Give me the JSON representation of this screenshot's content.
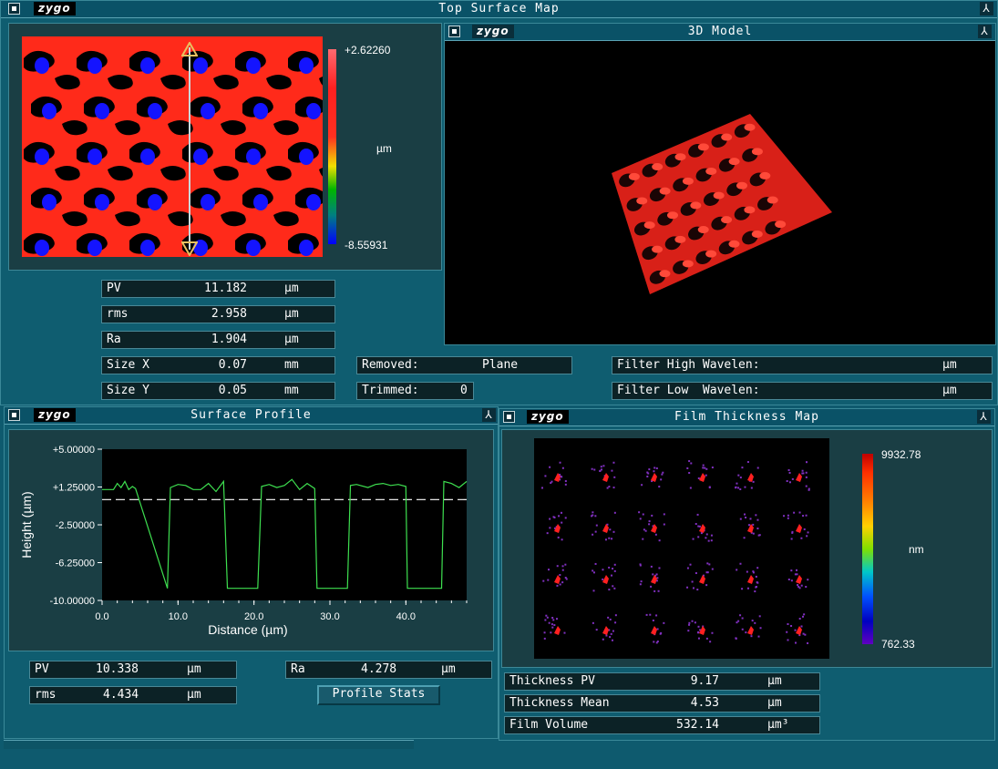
{
  "top_window": {
    "title": "Top Surface Map",
    "logo": "zygo"
  },
  "surface_map": {
    "colorbar_max": "+2.62260",
    "colorbar_min": "-8.55931",
    "colorbar_unit": "µm",
    "colors": {
      "high": "#ff2a1a",
      "mid": "#00c800",
      "low": "#1414ff"
    }
  },
  "surface_stats": [
    {
      "label": "PV",
      "value": "11.182",
      "unit": "µm"
    },
    {
      "label": "rms",
      "value": "2.958",
      "unit": "µm"
    },
    {
      "label": "Ra",
      "value": "1.904",
      "unit": "µm"
    },
    {
      "label": "Size X",
      "value": "0.07",
      "unit": "mm"
    },
    {
      "label": "Size Y",
      "value": "0.05",
      "unit": "mm"
    }
  ],
  "removed": {
    "label": "Removed:",
    "value": "Plane"
  },
  "trimmed": {
    "label": "Trimmed:",
    "value": "0"
  },
  "filter_high": {
    "label": "Filter High Wavelen:",
    "unit": "µm"
  },
  "filter_low": {
    "label": "Filter Low  Wavelen:",
    "unit": "µm"
  },
  "model_window": {
    "title": "3D Model",
    "logo": "zygo"
  },
  "profile_window": {
    "title": "Surface Profile",
    "logo": "zygo"
  },
  "profile_chart": {
    "ylabel": "Height (µm)",
    "xlabel": "Distance (µm)",
    "y_ticks": [
      "+5.00000",
      "+1.25000",
      "-2.50000",
      "-6.25000",
      "-10.00000"
    ],
    "x_ticks": [
      "0.0",
      "10.0",
      "20.0",
      "30.0",
      "40.0"
    ]
  },
  "chart_data": {
    "type": "line",
    "xlabel": "Distance (µm)",
    "ylabel": "Height (µm)",
    "xlim": [
      0,
      48
    ],
    "ylim": [
      -10,
      5
    ],
    "reference_line": 0,
    "x": [
      0,
      1.5,
      2,
      2.5,
      3,
      3.5,
      4,
      4.4,
      8.6,
      9,
      10,
      11,
      12,
      13,
      14,
      15,
      16,
      16.5,
      20.5,
      21,
      22,
      23,
      24,
      25,
      26,
      27,
      28,
      28.3,
      32.3,
      32.7,
      33.5,
      35,
      36,
      37,
      38,
      39,
      40,
      40.2,
      44.7,
      45,
      46,
      47,
      48
    ],
    "y": [
      1,
      1,
      1.6,
      1.2,
      1.8,
      1.0,
      1.3,
      1.1,
      -8.8,
      1.2,
      1.5,
      1.4,
      1.0,
      1.0,
      1.6,
      0.8,
      1.8,
      -8.8,
      -8.8,
      1.3,
      1.5,
      1.2,
      1.4,
      2.0,
      1.0,
      1.6,
      1.1,
      -8.8,
      -8.8,
      1.4,
      1.5,
      1.2,
      1.5,
      1.6,
      1.4,
      1.5,
      1.3,
      -8.8,
      -8.8,
      1.8,
      1.6,
      1.2,
      1.8
    ]
  },
  "profile_stats": {
    "pv": {
      "label": "PV",
      "value": "10.338",
      "unit": "µm"
    },
    "rms": {
      "label": "rms",
      "value": "4.434",
      "unit": "µm"
    },
    "ra": {
      "label": "Ra",
      "value": "4.278",
      "unit": "µm"
    },
    "button": "Profile Stats"
  },
  "film_window": {
    "title": "Film Thickness Map",
    "logo": "zygo"
  },
  "film_map": {
    "colorbar_max": "9932.78",
    "colorbar_min": "762.33",
    "colorbar_unit": "nm"
  },
  "film_stats": [
    {
      "label": "Thickness PV",
      "value": "9.17",
      "unit": "µm"
    },
    {
      "label": "Thickness Mean",
      "value": "4.53",
      "unit": "µm"
    },
    {
      "label": "Film Volume",
      "value": "532.14",
      "unit": "µm³"
    }
  ]
}
